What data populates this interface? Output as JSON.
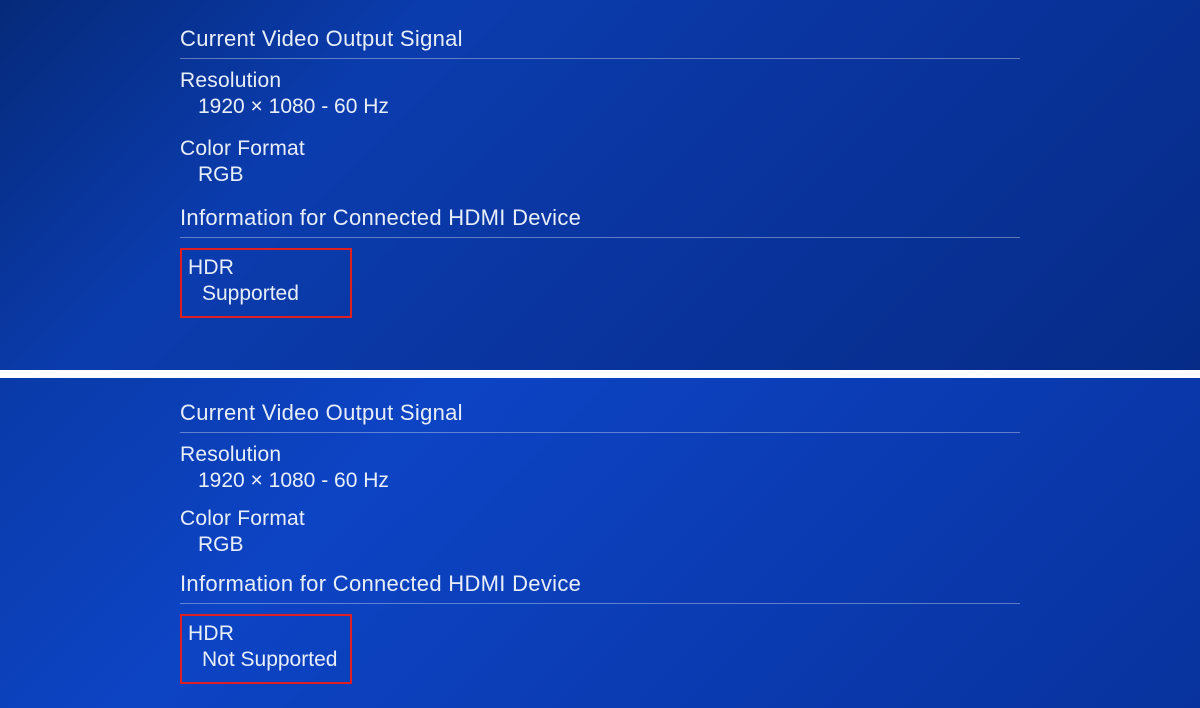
{
  "top": {
    "section1_title": "Current Video Output Signal",
    "resolution_label": "Resolution",
    "resolution_value": "1920 × 1080 - 60 Hz",
    "color_format_label": "Color Format",
    "color_format_value": "RGB",
    "section2_title": "Information for Connected HDMI Device",
    "hdr_label": "HDR",
    "hdr_value": "Supported"
  },
  "bottom": {
    "section1_title": "Current Video Output Signal",
    "resolution_label": "Resolution",
    "resolution_value": "1920 × 1080 - 60 Hz",
    "color_format_label": "Color Format",
    "color_format_value": "RGB",
    "section2_title": "Information for Connected HDMI Device",
    "hdr_label": "HDR",
    "hdr_value": "Not Supported"
  },
  "colors": {
    "highlight_border": "#e02020"
  }
}
